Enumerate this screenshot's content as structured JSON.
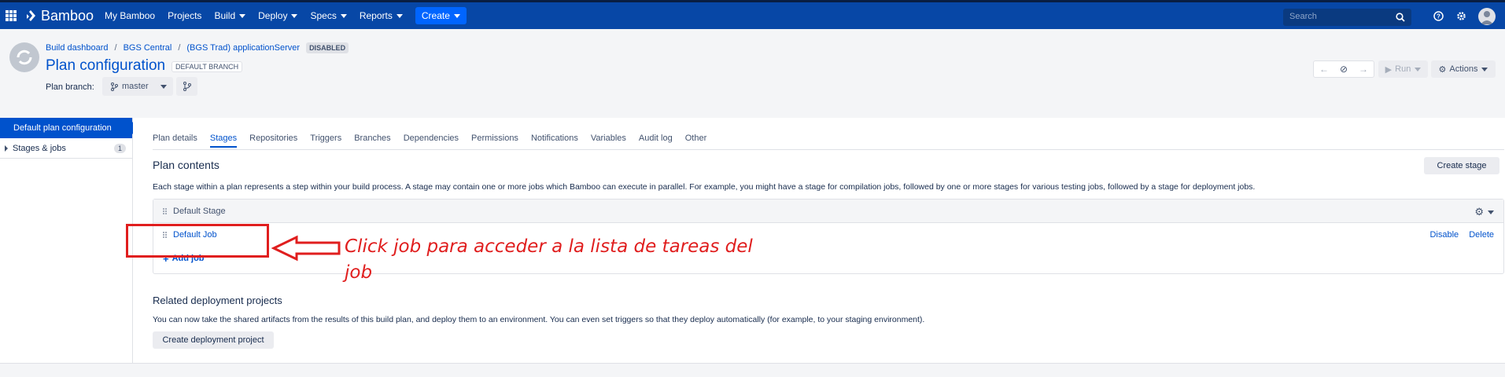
{
  "topnav": {
    "brand": "Bamboo",
    "items": [
      {
        "label": "My Bamboo",
        "dropdown": false
      },
      {
        "label": "Projects",
        "dropdown": false
      },
      {
        "label": "Build",
        "dropdown": true
      },
      {
        "label": "Deploy",
        "dropdown": true
      },
      {
        "label": "Specs",
        "dropdown": true
      },
      {
        "label": "Reports",
        "dropdown": true
      }
    ],
    "create_label": "Create",
    "search_placeholder": "Search",
    "bg_color": "#0747a6"
  },
  "header": {
    "breadcrumb": [
      "Build dashboard",
      "BGS Central",
      "(BGS Trad) applicationServer"
    ],
    "status_badge": "DISABLED",
    "title": "Plan configuration",
    "default_branch_badge": "DEFAULT BRANCH",
    "plan_branch_label": "Plan branch:",
    "branch_value": "master",
    "run_label": "Run",
    "actions_label": "Actions"
  },
  "sidebar": {
    "active_item": "Default plan configuration",
    "items": [
      {
        "label": "Stages & jobs",
        "count": "1"
      }
    ]
  },
  "main": {
    "tabs": [
      "Plan details",
      "Stages",
      "Repositories",
      "Triggers",
      "Branches",
      "Dependencies",
      "Permissions",
      "Notifications",
      "Variables",
      "Audit log",
      "Other"
    ],
    "active_tab": "Stages",
    "section_title": "Plan contents",
    "create_stage_label": "Create stage",
    "description": "Each stage within a plan represents a step within your build process. A stage may contain one or more jobs which Bamboo can execute in parallel. For example, you might have a stage for compilation jobs, followed by one or more stages for various testing jobs, followed by a stage for deployment jobs.",
    "stage": {
      "name": "Default Stage",
      "job": "Default Job",
      "disable_label": "Disable",
      "delete_label": "Delete",
      "add_job_label": "Add job"
    },
    "related_title": "Related deployment projects",
    "related_desc": "You can now take the shared artifacts from the results of this build plan, and deploy them to an environment. You can even set triggers so that they deploy automatically (for example, to your staging environment).",
    "create_deployment_label": "Create deployment project"
  },
  "annotation": {
    "text": "Click job para acceder a la lista de tareas del job",
    "color": "#e01e1e"
  }
}
